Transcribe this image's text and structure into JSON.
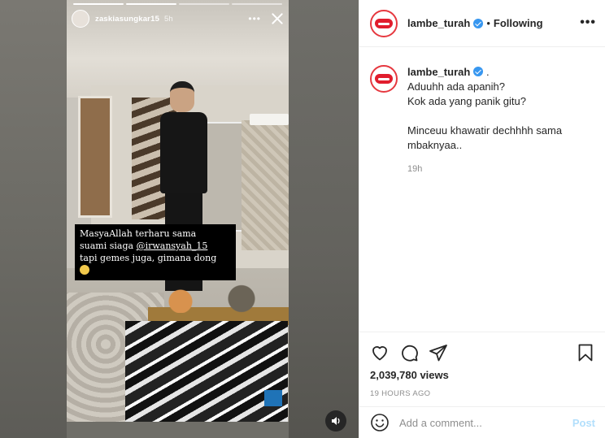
{
  "story": {
    "username": "zaskiasungkar15",
    "time": "5h",
    "more_glyph": "•••",
    "close_icon": "close-icon",
    "caption": {
      "line1": "MasyaAllah terharu sama",
      "line2_prefix": "suami siaga ",
      "mention": "@irwansyah_15",
      "line3": "tapi gemes juga, gimana dong"
    },
    "sound_icon": "speaker-icon"
  },
  "post": {
    "header": {
      "username": "lambe_turah",
      "separator": "•",
      "follow_state": "Following",
      "more_glyph": "•••"
    },
    "caption": {
      "username": "lambe_turah",
      "trailing": ".",
      "line1": "Aduuhh ada apanih?",
      "line2": "Kok ada yang panik gitu?",
      "line3": "Minceuu khawatir dechhhh sama",
      "line4": "mbaknyaa..",
      "time": "19h"
    },
    "views": "2,039,780 views",
    "posted_ago": "19 HOURS AGO",
    "comment_input": {
      "placeholder": "Add a comment...",
      "value": ""
    },
    "post_button": "Post"
  },
  "colors": {
    "link_blue": "#3897f0",
    "post_disabled": "#b2dffc",
    "brand_lips": "#e11d2d"
  }
}
